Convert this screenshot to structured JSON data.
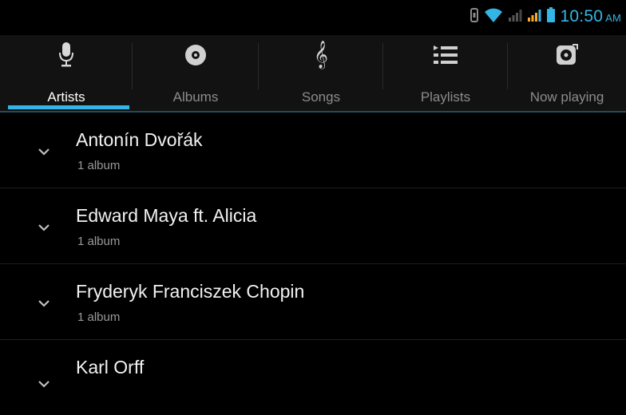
{
  "colors": {
    "accent": "#33b5e5",
    "background": "#000000",
    "tab_background": "#121212",
    "label_inactive": "#8c8c8c",
    "subtext": "#9a9a9a",
    "signal_orange": "#ffa726"
  },
  "status_bar": {
    "time": "10:50",
    "ampm": "AM",
    "icons": [
      "vibrate-icon",
      "wifi-icon",
      "signal-icon",
      "signal-icon",
      "battery-icon"
    ]
  },
  "tabs": [
    {
      "label": "Artists",
      "icon": "microphone-icon",
      "active": true
    },
    {
      "label": "Albums",
      "icon": "album-icon",
      "active": false
    },
    {
      "label": "Songs",
      "icon": "treble-clef-icon",
      "active": false
    },
    {
      "label": "Playlists",
      "icon": "playlist-icon",
      "active": false
    },
    {
      "label": "Now playing",
      "icon": "now-playing-icon",
      "active": false
    }
  ],
  "artists": [
    {
      "name": "Antonín Dvořák",
      "albums": "1 album"
    },
    {
      "name": "Edward Maya ft. Alicia",
      "albums": "1 album"
    },
    {
      "name": "Fryderyk Franciszek Chopin",
      "albums": "1 album"
    },
    {
      "name": "Karl Orff",
      "albums": ""
    }
  ]
}
